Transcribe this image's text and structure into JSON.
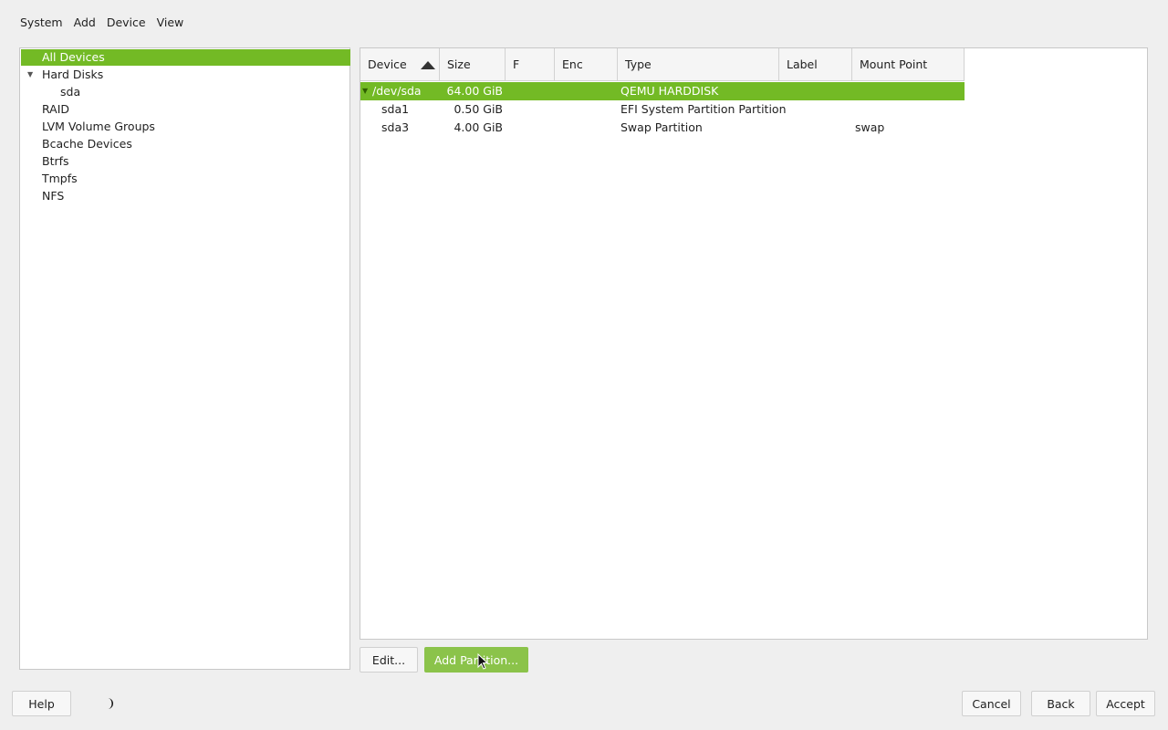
{
  "menubar": {
    "items": [
      {
        "label": "System"
      },
      {
        "label": "Add"
      },
      {
        "label": "Device"
      },
      {
        "label": "View"
      }
    ]
  },
  "sidebar": {
    "items": [
      {
        "label": "All Devices",
        "selected": true
      },
      {
        "label": "Hard Disks",
        "expanded": true
      },
      {
        "label": "sda"
      },
      {
        "label": "RAID"
      },
      {
        "label": "LVM Volume Groups"
      },
      {
        "label": "Bcache Devices"
      },
      {
        "label": "Btrfs"
      },
      {
        "label": "Tmpfs"
      },
      {
        "label": "NFS"
      }
    ]
  },
  "table": {
    "columns": [
      "Device",
      "Size",
      "F",
      "Enc",
      "Type",
      "Label",
      "Mount Point"
    ],
    "rows": [
      {
        "device": "/dev/sda",
        "size": "64.00 GiB",
        "f": "",
        "enc": "",
        "type": "QEMU HARDDISK",
        "label": "",
        "mount": "",
        "selected": true
      },
      {
        "device": "sda1",
        "size": "0.50 GiB",
        "f": "",
        "enc": "",
        "type": "EFI System Partition Partition",
        "label": "",
        "mount": ""
      },
      {
        "device": "sda3",
        "size": "4.00 GiB",
        "f": "",
        "enc": "",
        "type": "Swap Partition",
        "label": "",
        "mount": "swap"
      }
    ]
  },
  "actions": {
    "edit": "Edit...",
    "add_partition": "Add Partition..."
  },
  "footer": {
    "help": "Help",
    "cancel": "Cancel",
    "back": "Back",
    "accept": "Accept"
  },
  "colors": {
    "selection": "#73ba25",
    "primary_button": "#8bc34a"
  },
  "icons": {
    "theme_toggle": "moon-icon",
    "sort": "sort-ascending-icon"
  }
}
